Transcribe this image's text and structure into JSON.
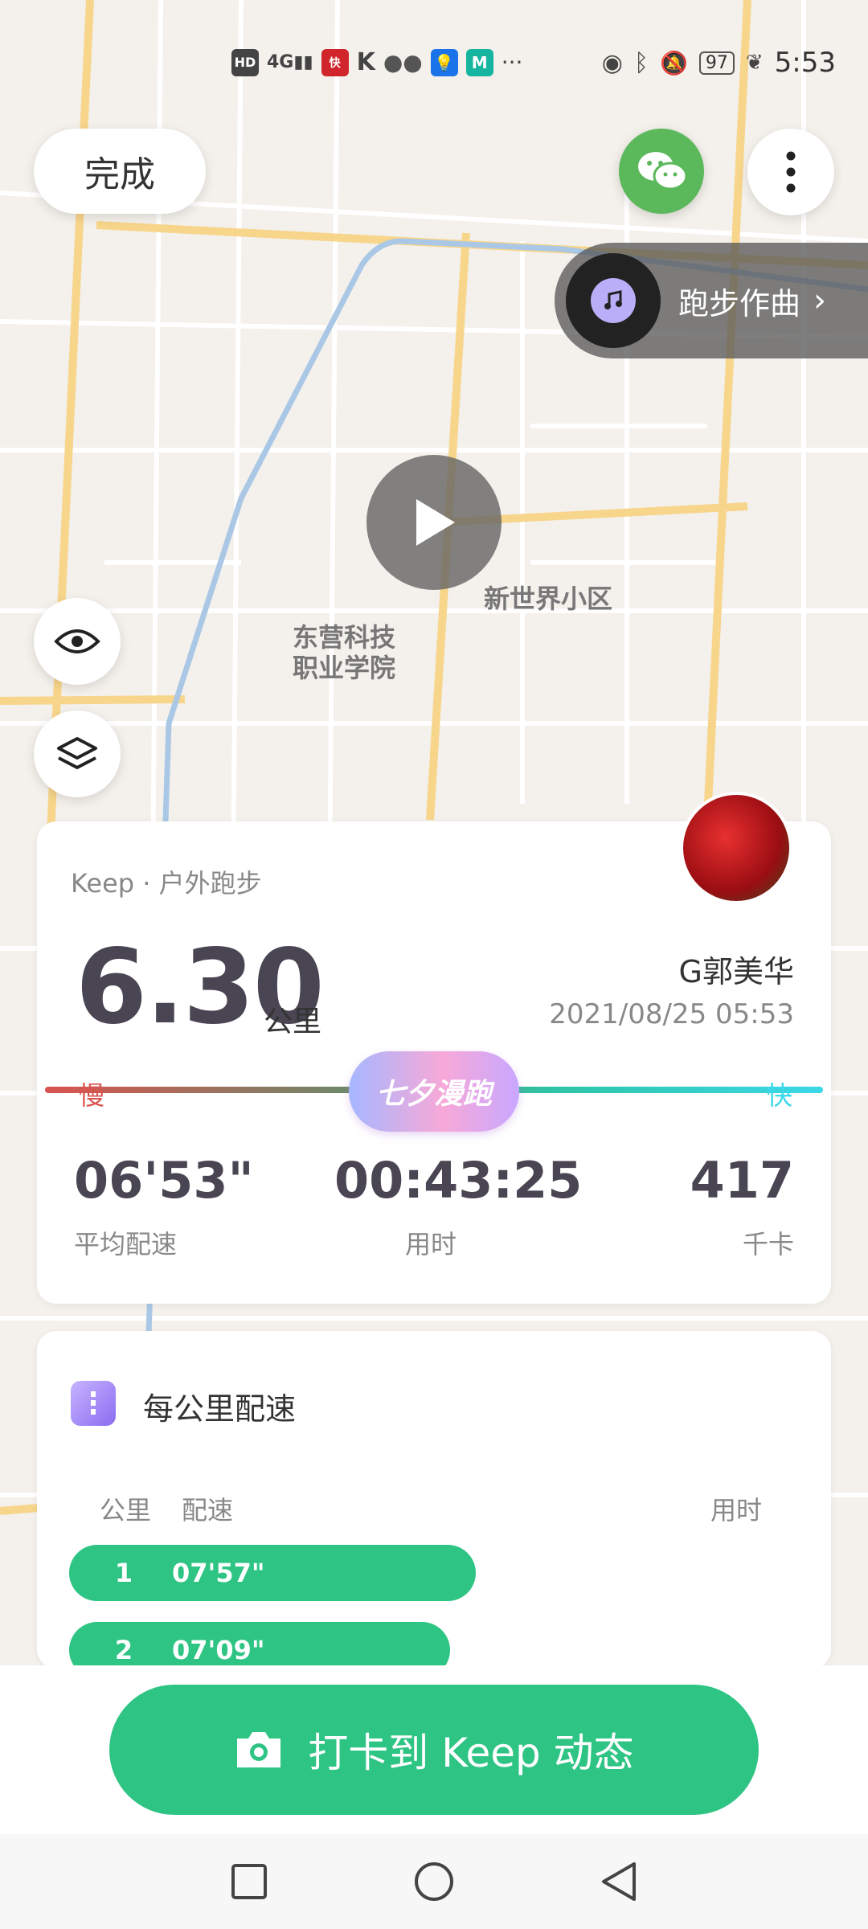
{
  "status_bar": {
    "time": "5:53",
    "battery": "97",
    "left_icons": [
      "HD",
      "4G",
      "signal",
      "kuaiyin",
      "k",
      "wechat",
      "bulb",
      "mi",
      "more"
    ],
    "right_icons": [
      "eye",
      "bluetooth",
      "mute",
      "battery",
      "leaf"
    ]
  },
  "top": {
    "done_label": "完成",
    "wechat_icon": "wechat-icon",
    "more_icon": "more-vertical-icon"
  },
  "compose": {
    "label": "跑步作曲",
    "chevron": "›"
  },
  "map": {
    "labels": [
      {
        "text": "新世界小区"
      },
      {
        "text": "东营科技\n职业学院"
      }
    ]
  },
  "summary": {
    "sport_type": "Keep · 户外跑步",
    "distance": "6.30",
    "distance_unit": "公里",
    "username": "G郭美华",
    "datetime": "2021/08/25 05:53",
    "slow": "慢",
    "fast": "快",
    "badge": "七夕漫跑",
    "stats": [
      {
        "value": "06'53\"",
        "label": "平均配速"
      },
      {
        "value": "00:43:25",
        "label": "用时"
      },
      {
        "value": "417",
        "label": "千卡"
      }
    ]
  },
  "splits": {
    "title": "每公里配速",
    "headers": {
      "km": "公里",
      "pace": "配速",
      "time": "用时"
    },
    "rows": [
      {
        "km": "1",
        "pace": "07'57\""
      },
      {
        "km": "2",
        "pace": "07'09\""
      }
    ]
  },
  "checkin": {
    "label": "打卡到 Keep 动态"
  },
  "colors": {
    "accent": "#2ec484",
    "text_dark": "#4a4553",
    "wechat": "#5bb85b"
  }
}
